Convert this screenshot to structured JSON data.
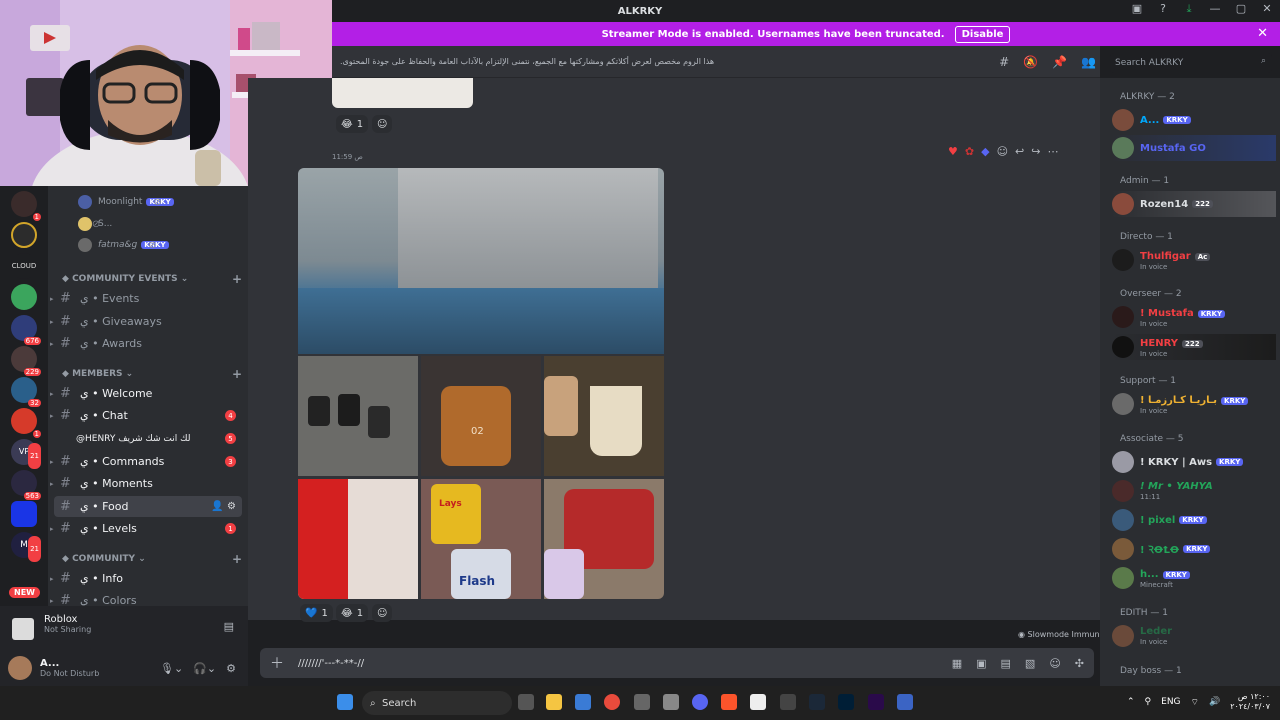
{
  "window": {
    "title": "ALKRKY"
  },
  "banner": {
    "text": "Streamer Mode is enabled. Usernames have been truncated.",
    "button": "Disable"
  },
  "channel_topic": "هذا الروم مخصص لعرض أكلاتكم ومشاركتها مع الجميع، نتمنى الإلتزام بالآداب العامة والحفاظ على جودة المحتوى.",
  "search": {
    "placeholder": "Search ALKRKY"
  },
  "voice_users": [
    {
      "name": "Moonlight",
      "tag": "KRKY"
    },
    {
      "name": "S...",
      "tag": ""
    },
    {
      "name": "fatma&g",
      "tag": "KRKY"
    }
  ],
  "categories": {
    "community_events": "COMMUNITY EVENTS",
    "members": "MEMBERS",
    "community": "COMMUNITY"
  },
  "channels": [
    {
      "label": "ي • Events",
      "badge": ""
    },
    {
      "label": "ي • Giveaways",
      "badge": ""
    },
    {
      "label": "ي • Awards",
      "badge": ""
    },
    {
      "label": "ي • Welcome",
      "badge": ""
    },
    {
      "label": "ي • Chat",
      "badge": "4"
    },
    {
      "label": "@HENRY لك انت شك شريف",
      "badge": "5"
    },
    {
      "label": "ي • Commands",
      "badge": "3"
    },
    {
      "label": "ي • Moments",
      "badge": ""
    },
    {
      "label": "ي • Food",
      "badge": ""
    },
    {
      "label": "ي • Levels",
      "badge": "1"
    },
    {
      "label": "ي • Info",
      "badge": ""
    },
    {
      "label": "ي • Colors",
      "badge": ""
    }
  ],
  "activity": {
    "game": "Roblox",
    "status": "Not Sharing"
  },
  "user": {
    "name": "A...",
    "status": "Do Not Disturb"
  },
  "guild_badges": [
    "1",
    "676",
    "229",
    "32",
    "1",
    "21",
    "563",
    "21"
  ],
  "new_badge": "NEW",
  "message": {
    "time": "11:59 ص",
    "reactions_top": [
      {
        "emoji": "😂",
        "count": "1"
      }
    ],
    "reactions_bottom": [
      {
        "emoji": "💙",
        "count": "1"
      },
      {
        "emoji": "😂",
        "count": "1"
      }
    ],
    "photo_text": [
      "02",
      "Lays",
      "Flash"
    ]
  },
  "composer": {
    "text": "///////'---*-**-//"
  },
  "slowmode": "Slowmode Immune",
  "members": {
    "groups": [
      {
        "header": "ALKRKY — 2",
        "rows": [
          {
            "name": "A...",
            "tag": "KRKY",
            "status": "",
            "color": "#00a8fc"
          },
          {
            "name": "Mustafa GO",
            "tag": "",
            "status": "",
            "color": "#5865f2"
          }
        ]
      },
      {
        "header": "Admin — 1",
        "rows": [
          {
            "name": "Rozen14",
            "tag": "222",
            "status": "",
            "color": "#dbdee1"
          }
        ]
      },
      {
        "header": "Directo — 1",
        "rows": [
          {
            "name": "Thulfigar",
            "tag": "Ac",
            "status": "In voice",
            "color": "#f23f43"
          }
        ]
      },
      {
        "header": "Overseer — 2",
        "rows": [
          {
            "name": "! Mustafa",
            "tag": "KRKY",
            "status": "In voice",
            "color": "#f23f43"
          },
          {
            "name": "HENRY",
            "tag": "222",
            "status": "In voice",
            "color": "#f23f43"
          }
        ]
      },
      {
        "header": "Support — 1",
        "rows": [
          {
            "name": "! بـاريـا كـارزمـا",
            "tag": "KRKY",
            "status": "In voice",
            "color": "#f0b232"
          }
        ]
      },
      {
        "header": "Associate — 5",
        "rows": [
          {
            "name": "! KRKY | Aws",
            "tag": "KRKY",
            "status": "",
            "color": "#dbdee1"
          },
          {
            "name": "! Mr • YAHYA",
            "tag": "",
            "status": "11:11",
            "color": "#23a55a"
          },
          {
            "name": "! pixel",
            "tag": "KRKY",
            "status": "",
            "color": "#23a55a"
          },
          {
            "name": "! ꝚꝊꝈꝊ",
            "tag": "KRKY",
            "status": "",
            "color": "#23a55a"
          },
          {
            "name": "h...",
            "tag": "KRKY",
            "status": "Minecraft",
            "color": "#23a55a"
          }
        ]
      },
      {
        "header": "EDITH — 1",
        "rows": [
          {
            "name": "Leder",
            "tag": "",
            "status": "In voice",
            "color": "#23a55a"
          }
        ]
      },
      {
        "header": "Day boss — 1",
        "rows": []
      }
    ]
  },
  "taskbar": {
    "search": "Search",
    "lang": "ENG",
    "time": "١٢:٠٠ ص",
    "date": "٢٠٢٤/٠٣/٠٧"
  }
}
